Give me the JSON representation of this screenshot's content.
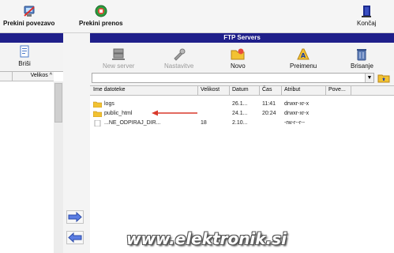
{
  "toolbar": {
    "disconnect_label": "Prekini povezavo",
    "stop_transfer_label": "Prekini prenos",
    "exit_label": "Končaj"
  },
  "left_pane": {
    "edit_label": "Briši",
    "columns": [
      "",
      "Velikos"
    ],
    "sort_indicator": "^"
  },
  "ftp_pane": {
    "title": "FTP Servers",
    "buttons": {
      "new_server": "New server",
      "settings": "Nastavitve",
      "new": "Novo",
      "rename": "Preimenu",
      "delete": "Brisanje"
    },
    "columns": [
      "Ime datoteke",
      "Velikost",
      "Datum",
      "Čas",
      "Atribut",
      "Pove..."
    ],
    "files": [
      {
        "name": "logs",
        "size": "",
        "date": "26.1...",
        "time": "11:41",
        "attr": "drwxr-xr-x",
        "type": "folder"
      },
      {
        "name": "public_html",
        "size": "",
        "date": "24.1...",
        "time": "20:24",
        "attr": "drwxr-xr-x",
        "type": "folder"
      },
      {
        "name": "...NE_ODPIRAJ_DIR...",
        "size": "18",
        "date": "2.10...",
        "time": "",
        "attr": "-rw-r--r--",
        "type": "file"
      }
    ]
  },
  "watermark": "www.elektronik.si",
  "colors": {
    "header_bg": "#1f1f8a",
    "arrow_red": "#d93a2b",
    "arrow_blue": "#4f6fd9"
  }
}
